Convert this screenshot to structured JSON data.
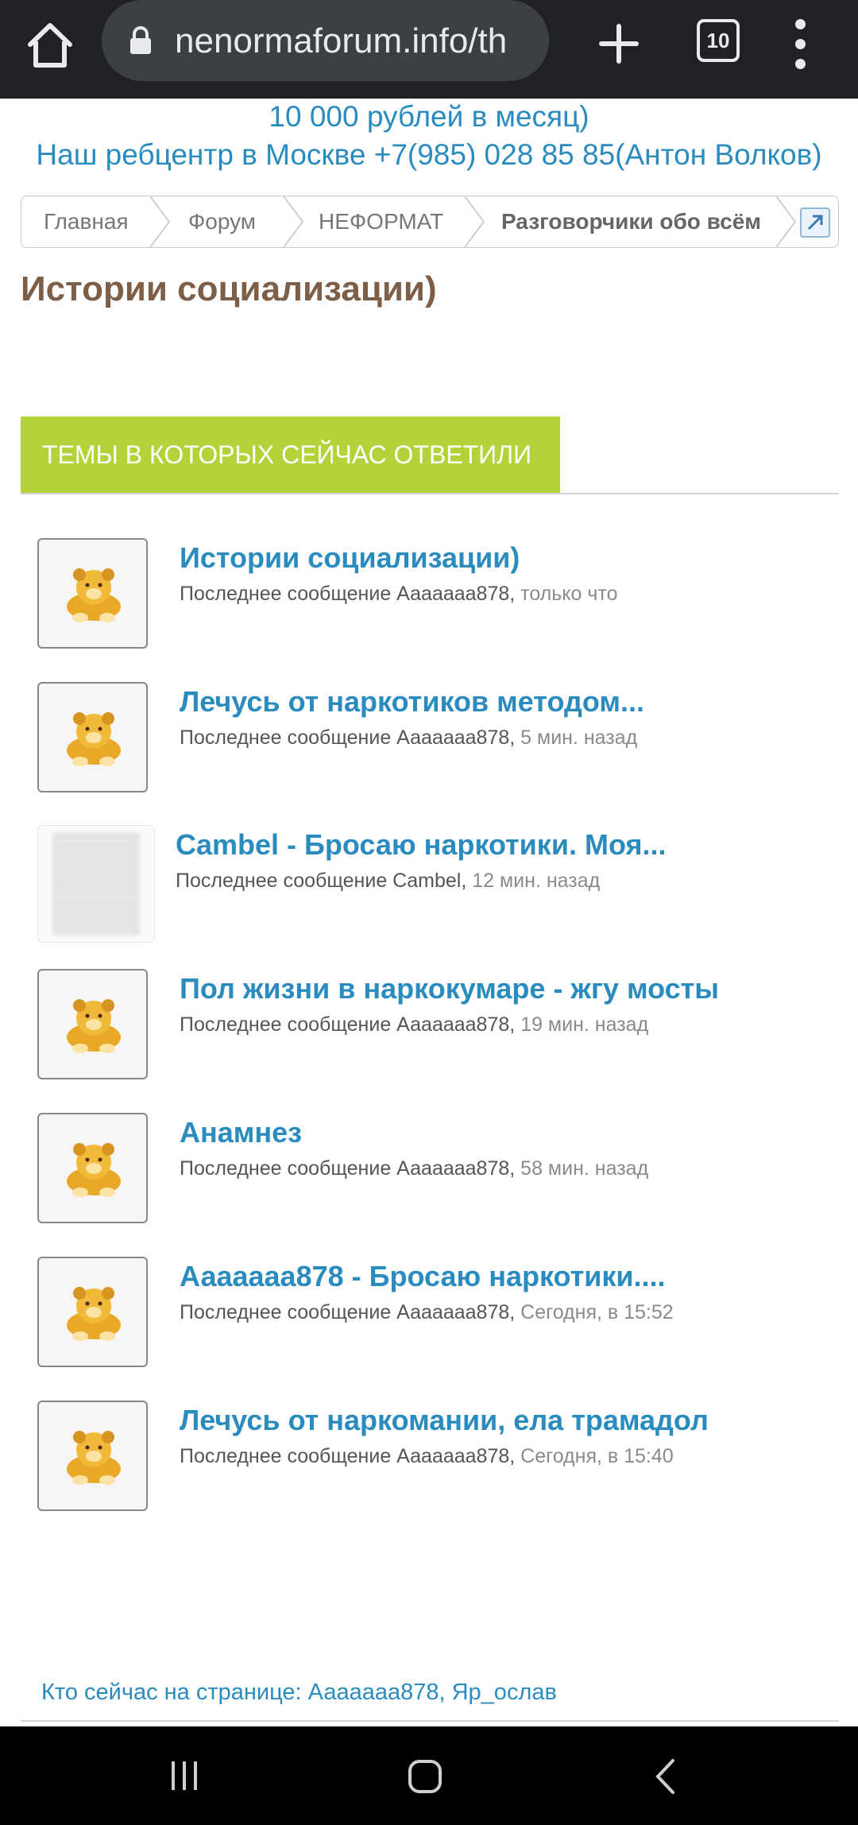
{
  "browser": {
    "url": "nenormaforum.info/th",
    "tab_count": "10"
  },
  "banner": {
    "line1": "10 000 рублей в месяц)",
    "line2": "Наш ребцентр в Москве +7(985) 028 85 85(Антон Волков)"
  },
  "breadcrumb": {
    "items": [
      "Главная",
      "Форум",
      "НЕФОРМАТ",
      "Разговорчики обо всём"
    ]
  },
  "page_title": "Истории социализации)",
  "section_title": "ТЕМЫ В КОТОРЫХ СЕЙЧАС ОТВЕТИЛИ",
  "threads": [
    {
      "title": "Истории социализации)",
      "meta": "Последнее сообщение Ааааааа878,",
      "time": "только что"
    },
    {
      "title": "Лечусь от наркотиков методом...",
      "meta": "Последнее сообщение Ааааааа878,",
      "time": "5 мин. назад"
    },
    {
      "title": "Cambel - Бросаю наркотики. Моя...",
      "meta": "Последнее сообщение Cambel,",
      "time": "12 мин. назад"
    },
    {
      "title": "Пол жизни в наркокумаре - жгу мосты",
      "meta": "Последнее сообщение Ааааааа878,",
      "time": "19 мин. назад"
    },
    {
      "title": "Анамнез",
      "meta": "Последнее сообщение Ааааааа878,",
      "time": "58 мин. назад"
    },
    {
      "title": "Ааааааа878 - Бросаю наркотики....",
      "meta": "Последнее сообщение Ааааааа878,",
      "time": "Сегодня, в 15:52"
    },
    {
      "title": "Лечусь от наркомании, ела трамадол",
      "meta": "Последнее сообщение Ааааааа878,",
      "time": "Сегодня, в 15:40"
    }
  ],
  "online": {
    "label": "Кто сейчас на странице:",
    "user1": "Ааааааа878",
    "separator": ",",
    "user2": "Яр_ослав"
  },
  "colors": {
    "link": "#2a8bbf",
    "title": "#7d5f47",
    "section_bg": "#b4d33a",
    "topbar": "#202124"
  }
}
